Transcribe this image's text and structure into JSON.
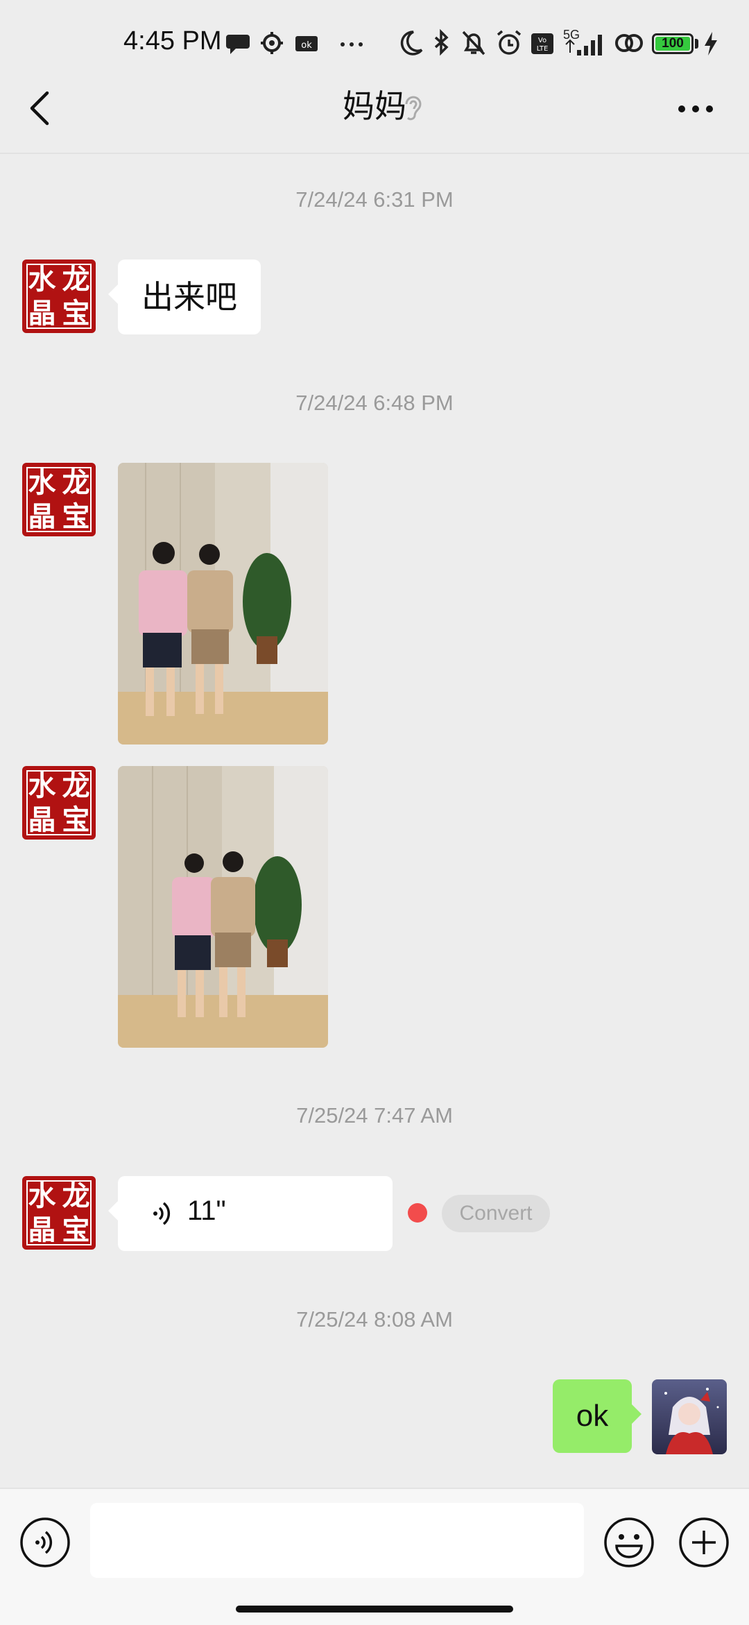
{
  "status_bar": {
    "time": "4:45 PM",
    "network": "5G",
    "battery": "100",
    "icons": [
      "chat-bubble-icon",
      "settings-icon",
      "vpn-icon",
      "more-dots-icon",
      "moon-icon",
      "bluetooth-icon",
      "mute-icon",
      "alarm-icon",
      "volte-icon",
      "signal-icon",
      "link-icon",
      "battery-icon",
      "charging-icon"
    ]
  },
  "header": {
    "title": "妈妈",
    "icons": [
      "back-icon",
      "ear-icon",
      "more-icon"
    ]
  },
  "messages": [
    {
      "timestamp": "7/24/24 6:31 PM",
      "type": "text",
      "text": "出来吧",
      "from": "contact"
    },
    {
      "timestamp": "7/24/24 6:48 PM",
      "type": "image",
      "from": "contact"
    },
    {
      "type": "image",
      "from": "contact"
    },
    {
      "timestamp": "7/25/24 7:47 AM",
      "type": "voice",
      "duration": "11\"",
      "convert_label": "Convert",
      "from": "contact"
    },
    {
      "timestamp": "7/25/24 8:08 AM",
      "type": "text",
      "text": "ok",
      "from": "me"
    }
  ],
  "contact_avatar": {
    "chars": [
      "水",
      "龙",
      "晶",
      "宝"
    ]
  },
  "input_bar": {
    "placeholder": "",
    "icons": [
      "voice-input-icon",
      "emoji-icon",
      "plus-icon"
    ]
  },
  "colors": {
    "background": "#ededed",
    "sent_bubble": "#95ec69",
    "received_bubble": "#ffffff",
    "unread_dot": "#f24c4c",
    "avatar_red": "#b11212"
  }
}
